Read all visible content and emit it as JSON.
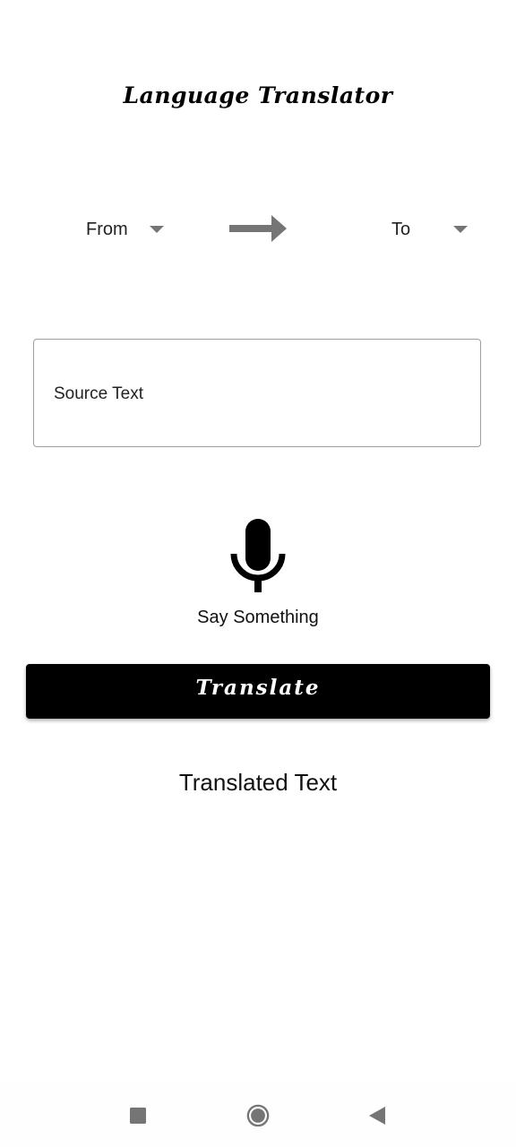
{
  "app": {
    "title": "Language Translator"
  },
  "language_select": {
    "from_label": "From",
    "to_label": "To",
    "arrow_icon": "right-arrow-icon"
  },
  "source": {
    "placeholder": "Source Text",
    "value": ""
  },
  "voice": {
    "icon": "microphone-icon",
    "label": "Say Something"
  },
  "translate_button": {
    "label": "Translate"
  },
  "result": {
    "text": "Translated Text"
  },
  "navigation": {
    "recent_icon": "square-recent-apps-icon",
    "home_icon": "circle-home-icon",
    "back_icon": "triangle-back-icon"
  },
  "colors": {
    "background": "#ffffff",
    "button": "#000000",
    "button_text": "#ffffff",
    "arrow": "#757575",
    "border": "#9e9e9e",
    "nav_icon": "#757575"
  }
}
